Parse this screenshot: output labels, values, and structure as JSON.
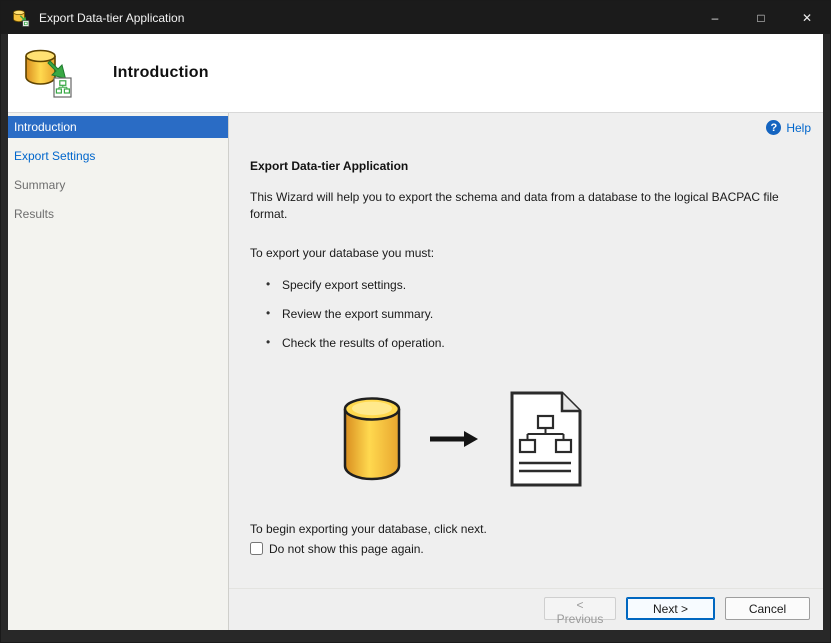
{
  "window": {
    "title": "Export Data-tier Application",
    "controls": {
      "minimize": "–",
      "maximize": "□",
      "close": "✕"
    }
  },
  "header": {
    "title": "Introduction"
  },
  "sidebar": {
    "items": [
      {
        "label": "Introduction",
        "state": "selected"
      },
      {
        "label": "Export Settings",
        "state": "enabled"
      },
      {
        "label": "Summary",
        "state": "disabled"
      },
      {
        "label": "Results",
        "state": "disabled"
      }
    ]
  },
  "content": {
    "help": {
      "label": "Help",
      "icon_glyph": "?"
    },
    "heading": "Export Data-tier Application",
    "description": "This Wizard will help you to export the schema and data from a database to the logical BACPAC file format.",
    "requirements_intro": "To export your database you must:",
    "bullets": [
      "Specify export settings.",
      "Review the export summary.",
      "Check the results of operation."
    ],
    "begin_text": "To begin exporting your database, click next.",
    "checkbox": {
      "label": "Do not show this page again.",
      "checked": false
    }
  },
  "footer": {
    "buttons": [
      {
        "label": "< Previous",
        "state": "disabled"
      },
      {
        "label": "Next >",
        "state": "default-focused"
      },
      {
        "label": "Cancel",
        "state": "enabled"
      }
    ]
  },
  "colors": {
    "titlebar_bg": "#1b1b1b",
    "selected_item_bg": "#2a6cc5",
    "link_blue": "#0066cc",
    "primary_button_border": "#0067c0",
    "database_yellow": "#ffd94f",
    "content_bg": "#efefef"
  }
}
